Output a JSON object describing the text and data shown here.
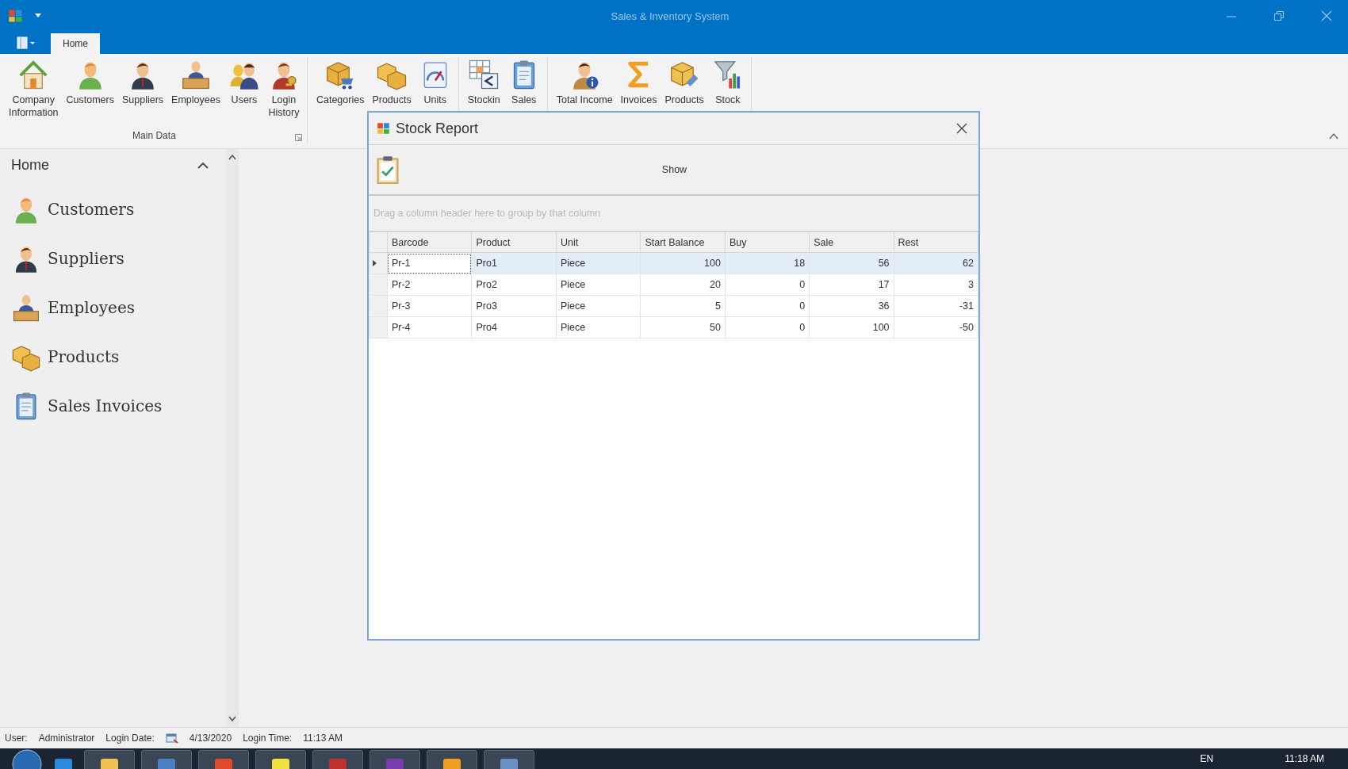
{
  "window": {
    "title": "Sales & Inventory System"
  },
  "ribbon": {
    "tabs": [
      {
        "label": "Home",
        "selected": true
      }
    ],
    "groups": [
      {
        "label": "Main Data",
        "buttons": [
          "Company\nInformation",
          "Customers",
          "Suppliers",
          "Employees",
          "Users",
          "Login\nHistory"
        ]
      },
      {
        "buttons": [
          "Categories",
          "Products",
          "Units"
        ]
      },
      {
        "buttons": [
          "Stockin",
          "Sales"
        ]
      },
      {
        "buttons": [
          "Total Income",
          "Invoices",
          "Products",
          "Stock"
        ]
      }
    ]
  },
  "sidebar": {
    "title": "Home",
    "items": [
      {
        "label": "Customers"
      },
      {
        "label": "Suppliers"
      },
      {
        "label": "Employees"
      },
      {
        "label": "Products"
      },
      {
        "label": "Sales Invoices"
      }
    ]
  },
  "dialog": {
    "title": "Stock Report",
    "show_button": "Show",
    "group_panel": "Drag a column header here to group by that column",
    "columns": [
      {
        "label": "Barcode",
        "kind": "text"
      },
      {
        "label": "Product",
        "kind": "text"
      },
      {
        "label": "Unit",
        "kind": "text"
      },
      {
        "label": "Start Balance",
        "kind": "number"
      },
      {
        "label": "Buy",
        "kind": "number"
      },
      {
        "label": "Sale",
        "kind": "number"
      },
      {
        "label": "Rest",
        "kind": "number"
      }
    ],
    "rows": [
      {
        "selected": true,
        "cells": [
          "Pr-1",
          "Pro1",
          "Piece",
          "100",
          "18",
          "56",
          "62"
        ]
      },
      {
        "selected": false,
        "cells": [
          "Pr-2",
          "Pro2",
          "Piece",
          "20",
          "0",
          "17",
          "3"
        ]
      },
      {
        "selected": false,
        "cells": [
          "Pr-3",
          "Pro3",
          "Piece",
          "5",
          "0",
          "36",
          "-31"
        ]
      },
      {
        "selected": false,
        "cells": [
          "Pr-4",
          "Pro4",
          "Piece",
          "50",
          "0",
          "100",
          "-50"
        ]
      }
    ]
  },
  "status_bar": {
    "user_label": "User:",
    "user": "Administrator",
    "date_label": "Login Date:",
    "date": "4/13/2020",
    "time_label": "Login Time:",
    "time": "11:13 AM"
  },
  "taskbar": {
    "language": "EN",
    "time": "11:18 AM"
  }
}
